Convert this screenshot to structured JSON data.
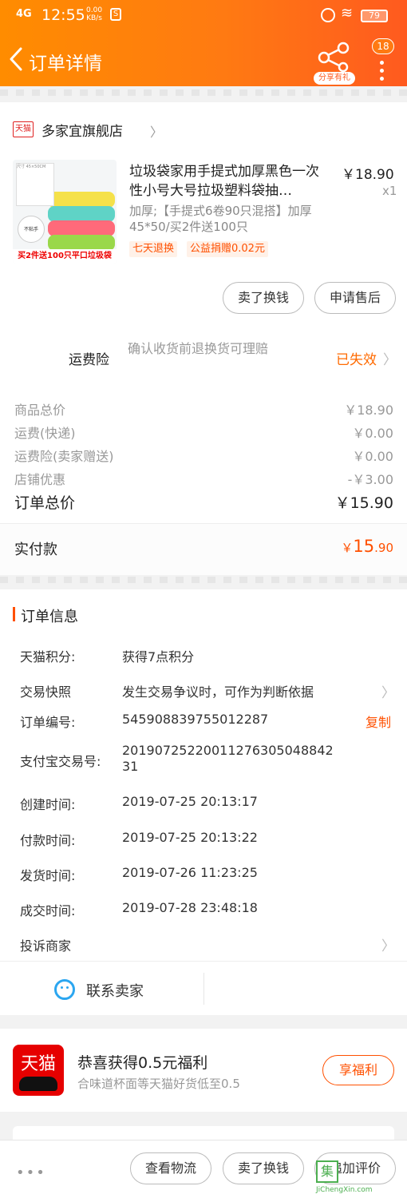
{
  "status_bar": {
    "signal": "4G",
    "time": "12:55",
    "speed_value": "0.00",
    "speed_unit": "KB/s",
    "sim": "S",
    "battery": "79"
  },
  "header": {
    "title": "订单详情",
    "share_label": "分享有礼",
    "more_badge": "18"
  },
  "shop": {
    "tag": "天猫",
    "name": "多家宜旗舰店"
  },
  "product": {
    "title": "垃圾袋家用手提式加厚黑色一次性小号大号拉圾塑料袋抽…",
    "price": "￥18.90",
    "qty": "x1",
    "sku": "加厚;【手提式6卷90只混搭】加厚45*50/买2件送100只",
    "tags": [
      "七天退换",
      "公益捐赠0.02元"
    ],
    "image_caption": "买2件送100只平口垃圾袋",
    "image_spec": "尺寸 45×50CM",
    "image_badge": "不粘手"
  },
  "actions": {
    "sell_btn": "卖了换钱",
    "after_sale_btn": "申请售后"
  },
  "insurance": {
    "label": "运费险",
    "desc": "确认收货前退换货可理赔",
    "status": "已失效"
  },
  "costs": [
    {
      "label": "商品总价",
      "value": "￥18.90"
    },
    {
      "label": "运费(快递)",
      "value": "￥0.00"
    },
    {
      "label": "运费险(卖家赠送)",
      "value": "￥0.00"
    },
    {
      "label": "店铺优惠",
      "value": "-￥3.00"
    }
  ],
  "total": {
    "label": "订单总价",
    "value": "￥15.90"
  },
  "paid": {
    "label": "实付款",
    "currency": "￥",
    "int": "15",
    "dec": ".90"
  },
  "order_info": {
    "heading": "订单信息",
    "rows": [
      {
        "label": "天猫积分:",
        "value": "获得7点积分"
      },
      {
        "label": "交易快照",
        "value": "发生交易争议时，可作为判断依据"
      },
      {
        "label": "订单编号:",
        "value": "545908839755012287"
      },
      {
        "label": "支付宝交易号:",
        "value": "20190725220011276305048842 31"
      },
      {
        "label": "创建时间:",
        "value": "2019-07-25 20:13:17"
      },
      {
        "label": "付款时间:",
        "value": "2019-07-25 20:13:22"
      },
      {
        "label": "发货时间:",
        "value": "2019-07-26 11:23:25"
      },
      {
        "label": "成交时间:",
        "value": "2019-07-28 23:48:18"
      },
      {
        "label": "投诉商家",
        "value": ""
      }
    ],
    "copy_label": "复制"
  },
  "contact": {
    "label": "联系卖家"
  },
  "promo": {
    "logo_text": "天猫",
    "title": "恭喜获得0.5元福利",
    "subtitle": "合味道杯面等天猫好货低至0.5",
    "button": "享福利"
  },
  "bottom_bar": {
    "more": "•••",
    "logistics": "查看物流",
    "sell": "卖了换钱",
    "review": "追加评价"
  },
  "watermark": {
    "char": "集",
    "url": "JiChengXin.com"
  }
}
